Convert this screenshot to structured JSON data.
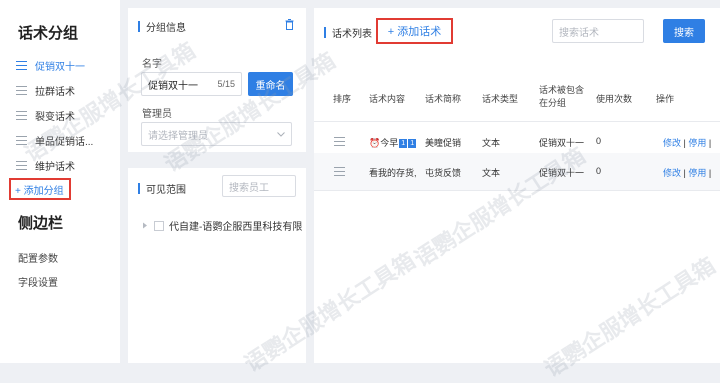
{
  "left": {
    "title": "话术分组",
    "groups": [
      {
        "label": "促销双十一",
        "active": true
      },
      {
        "label": "拉群话术",
        "active": false
      },
      {
        "label": "裂变话术",
        "active": false
      },
      {
        "label": "单品促销话...",
        "active": false
      },
      {
        "label": "维护话术",
        "active": false
      }
    ],
    "add_group": "+ 添加分组",
    "sidebar_title": "侧边栏",
    "config_params": "配置参数",
    "word_settings": "字段设置"
  },
  "group_info": {
    "title": "分组信息",
    "name_label": "名字",
    "name_value": "促销双十一",
    "name_count": "5/15",
    "rename": "重命名",
    "admin_label": "管理员",
    "admin_placeholder": "请选择管理员"
  },
  "visibility": {
    "title": "可见范围",
    "search_placeholder": "搜索员工",
    "tree_item": "代自建-语鹦企服西里科技有限"
  },
  "scripts": {
    "title": "话术列表",
    "add": "+ 添加话术",
    "search_placeholder": "搜索话术",
    "search_btn": "搜索",
    "headers": {
      "sort": "排序",
      "content": "话术内容",
      "abbr": "话术简称",
      "type": "话术类型",
      "group_line1": "话术被包含",
      "group_line2": "在分组",
      "uses": "使用次数",
      "ops": "操作"
    },
    "rows": [
      {
        "content": "今早",
        "abbr": "美瞳促销",
        "type": "文本",
        "group": "促销双十一",
        "uses": "0",
        "edit": "修改",
        "disable": "停用"
      },
      {
        "content": "看我的存货,",
        "abbr": "屯货反馈",
        "type": "文本",
        "group": "促销双十一",
        "uses": "0",
        "edit": "修改",
        "disable": "停用"
      }
    ]
  },
  "watermark": "语鹦企服增长工具箱",
  "colors": {
    "accent": "#2f7fe4",
    "highlight": "#e13b33"
  }
}
